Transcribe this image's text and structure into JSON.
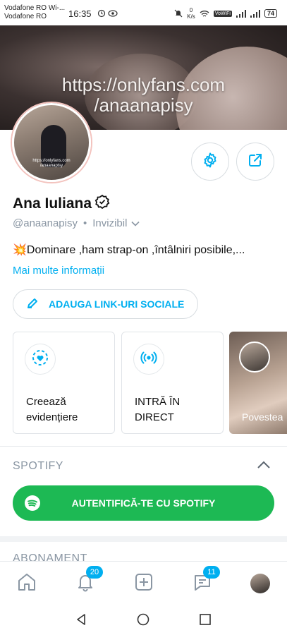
{
  "status_bar": {
    "carrier1": "Vodafone RO Wi-...",
    "carrier2": "Vodafone RO",
    "time": "16:35",
    "speed": "0",
    "speed_unit": "K/s",
    "volte": "VoWiFi",
    "battery": "74"
  },
  "cover": {
    "line1": "https://onlyfans.com",
    "line2": "/anaanapisy"
  },
  "avatar": {
    "caption1": "https://onlyfans.com",
    "caption2": "/anaanapisy"
  },
  "profile": {
    "name": "Ana Iuliana",
    "handle": "@anaanapisy",
    "separator": "•",
    "status": "Invizibil",
    "bio": "💥Dominare ,ham strap-on ,întâlniri posibile,...",
    "more_info": "Mai multe informații"
  },
  "buttons": {
    "social_links": "ADAUGA LINK-URI SOCIALE"
  },
  "cards": {
    "highlight_line1": "Creează",
    "highlight_line2": "evidențiere",
    "live_line1": "INTRĂ ÎN",
    "live_line2": "DIRECT",
    "story": "Povestea"
  },
  "spotify": {
    "title": "SPOTIFY",
    "button": "AUTENTIFICĂ-TE CU SPOTIFY"
  },
  "subscription": {
    "title": "ABONAMENT"
  },
  "bottom_nav": {
    "notifications_badge": "20",
    "messages_badge": "11"
  },
  "colors": {
    "accent": "#00aff0",
    "spotify": "#1db954",
    "muted": "#8a96a3"
  },
  "icons": [
    "home-icon",
    "bell-icon",
    "plus-square-icon",
    "message-icon",
    "gear-icon",
    "share-icon",
    "pencil-icon",
    "heart-icon",
    "broadcast-icon",
    "spotify-icon"
  ]
}
